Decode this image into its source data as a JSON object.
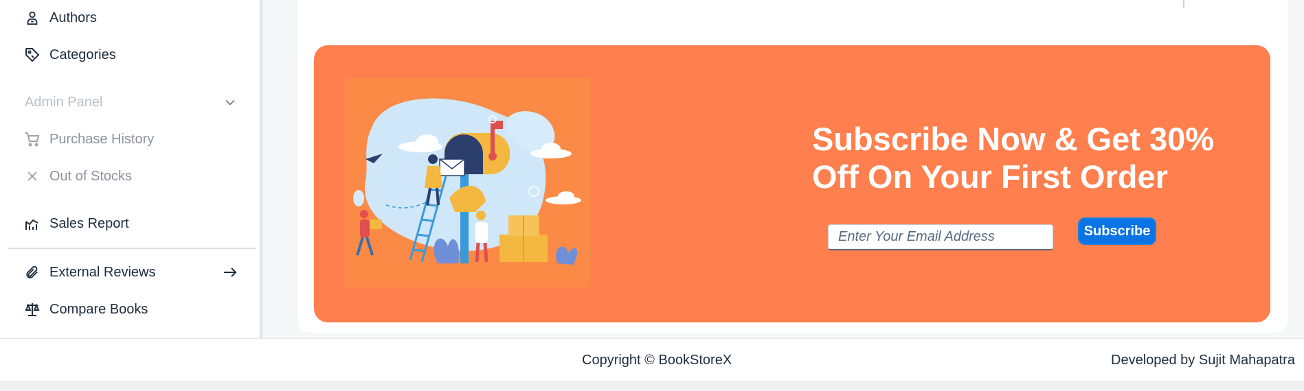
{
  "sidebar": {
    "items": [
      {
        "label": "Authors",
        "icon": "author-icon"
      },
      {
        "label": "Categories",
        "icon": "tag-icon"
      },
      {
        "label": "Admin Panel",
        "icon": "chevron-down-icon"
      },
      {
        "label": "Purchase History",
        "icon": "cart-icon"
      },
      {
        "label": "Out of Stocks",
        "icon": "close-icon"
      },
      {
        "label": "Sales Report",
        "icon": "chart-line-icon"
      },
      {
        "label": "External Reviews",
        "icon": "paperclip-icon"
      },
      {
        "label": "Compare Books",
        "icon": "scale-icon"
      }
    ]
  },
  "banner": {
    "headline": "Subscribe Now & Get 30% Off On Your First Order",
    "email_placeholder": "Enter Your Email Address",
    "subscribe_label": "Subscribe",
    "background_color": "#ff7f4e",
    "button_color": "#0b74e5"
  },
  "footer": {
    "copyright": "Copyright © BookStoreX",
    "developer": "Developed by Sujit Mahapatra"
  }
}
